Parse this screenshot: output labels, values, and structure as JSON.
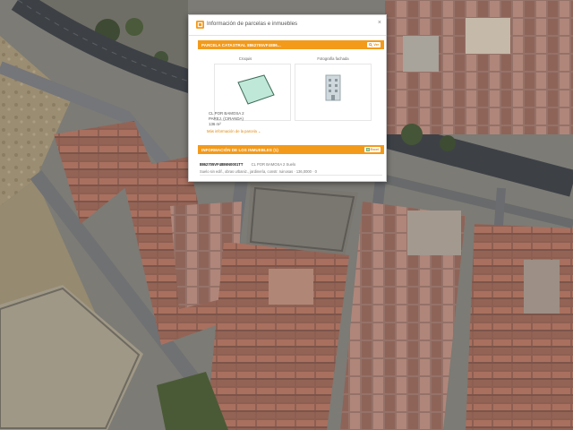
{
  "popup": {
    "title": "Información de parcelas e inmuebles",
    "close_label": "×",
    "parcel_section": {
      "header": "PARCELA CATASTRAL 8862705VF4886...",
      "header_button": "Ver",
      "croquis_label": "Croquis",
      "photo_label": "Fotografía fachada",
      "address_line1": "CL POR BAMOSA 2",
      "address_line2": "PAREJ. (CIRANDA)",
      "area": "136 m²",
      "more_link": "Más información de la parcela"
    },
    "property_section": {
      "header": "INFORMACIÓN DE LOS INMUEBLES (1)",
      "header_button": "Excel",
      "reference": "8862705VF4886N0001TT",
      "address": "CL POR BAMOSA 2 Suelo",
      "details": "Suelo sin edif., obras urbaniz., jardinería, constr. ruinosas · 136,0000 · 0"
    }
  },
  "colors": {
    "accent": "#f39a1b",
    "road": "#3d4146"
  }
}
